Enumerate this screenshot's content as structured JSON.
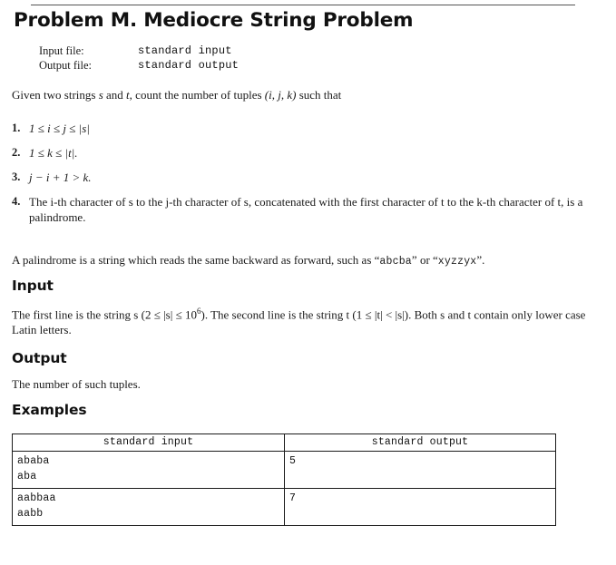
{
  "document": {
    "clipped_running_header": "",
    "title": "Problem M. Mediocre String Problem",
    "meta": {
      "input_label": "Input file:",
      "input_value": "standard input",
      "output_label": "Output file:",
      "output_value": "standard output"
    },
    "intro": {
      "prefix": "Given two strings ",
      "s": "s",
      "mid": " and ",
      "t": "t",
      "suffix": ", count the number of tuples ",
      "tuple": "(i, j, k)",
      "end": " such that"
    },
    "conditions": [
      {
        "num": "1.",
        "text": "1 ≤ i ≤ j ≤ |s|"
      },
      {
        "num": "2.",
        "text": "1 ≤ k ≤ |t|."
      },
      {
        "num": "3.",
        "text": "j − i + 1 > k."
      },
      {
        "num": "4.",
        "text": "The i-th character of s to the j-th character of s, concatenated with the first character of t to the k-th character of t, is a palindrome."
      }
    ],
    "palindrome_note": {
      "prefix": "A palindrome is a string which reads the same backward as forward, such as “",
      "example1": "abcba",
      "mid": "” or “",
      "example2": "xyzzyx",
      "suffix": "”."
    },
    "sections": {
      "input_heading": "Input",
      "input_text_a": "The first line is the string s (2 ≤ |s| ≤ 10",
      "input_exponent": "6",
      "input_text_b": "). The second line is the string t (1 ≤ |t| < |s|). Both s and t contain only lower case Latin letters.",
      "output_heading": "Output",
      "output_text": "The number of such tuples.",
      "examples_heading": "Examples"
    },
    "examples_table": {
      "headers": [
        "standard input",
        "standard output"
      ],
      "rows": [
        {
          "input_line1": "ababa",
          "input_line2": "aba",
          "output": "5"
        },
        {
          "input_line1": "aabbaa",
          "input_line2": "aabb",
          "output": "7"
        }
      ]
    }
  }
}
